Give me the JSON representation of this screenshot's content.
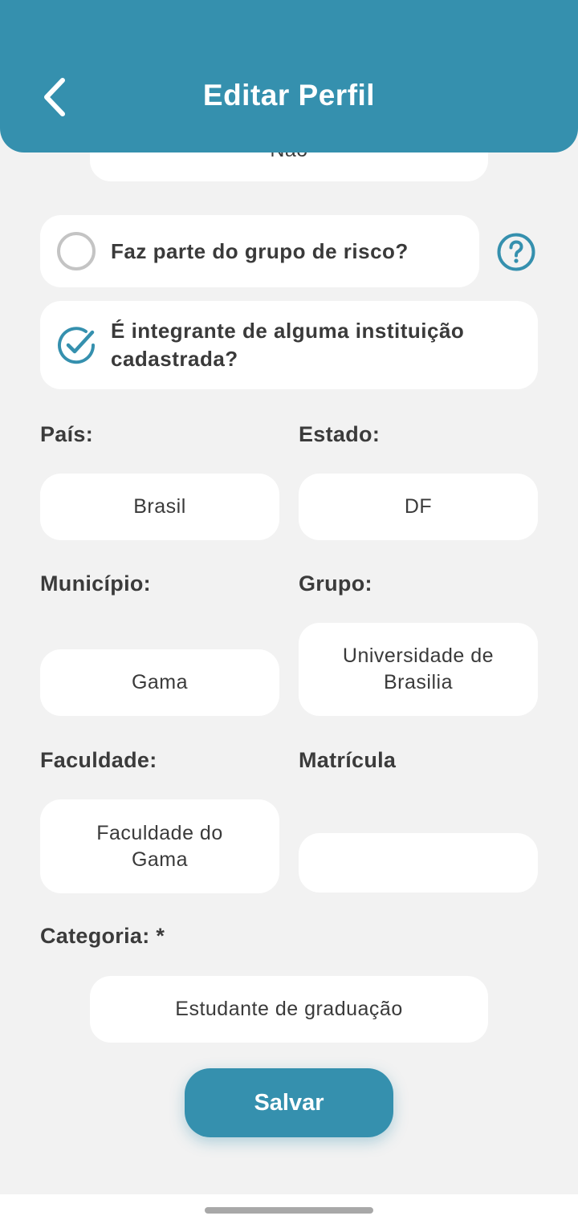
{
  "header": {
    "title": "Editar Perfil",
    "back_icon": "chevron-left-icon"
  },
  "partial_field": {
    "value": "Não"
  },
  "risk_group": {
    "question": "Faz parte do grupo de risco?",
    "checked": false,
    "help_icon": "question-circle-icon"
  },
  "institution": {
    "question": "É integrante de alguma instituição cadastrada?",
    "checked": true
  },
  "fields": {
    "pais": {
      "label": "País:",
      "value": "Brasil"
    },
    "estado": {
      "label": "Estado:",
      "value": "DF"
    },
    "municipio": {
      "label": "Município:",
      "value": "Gama"
    },
    "grupo": {
      "label": "Grupo:",
      "value": "Universidade de Brasilia"
    },
    "faculdade": {
      "label": "Faculdade:",
      "value": "Faculdade do Gama"
    },
    "matricula": {
      "label": "Matrícula",
      "value": ""
    },
    "categoria": {
      "label": "Categoria: *",
      "value": "Estudante de graduação"
    }
  },
  "save_button": {
    "label": "Salvar"
  },
  "colors": {
    "primary": "#3590ae",
    "background": "#f2f2f2",
    "card": "#ffffff"
  }
}
